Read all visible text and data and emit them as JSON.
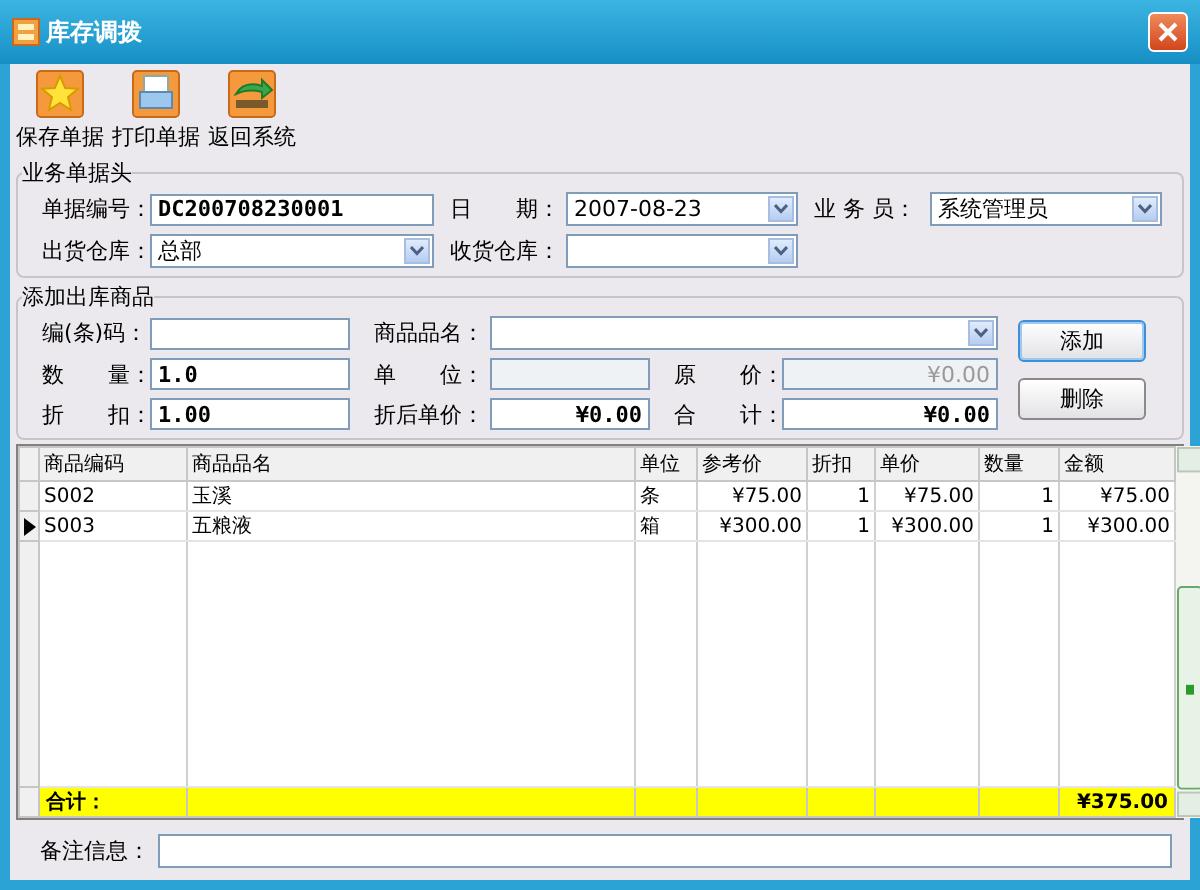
{
  "window": {
    "title": "库存调拨"
  },
  "toolbar": [
    {
      "label": "保存单据"
    },
    {
      "label": "打印单据"
    },
    {
      "label": "返回系统"
    }
  ],
  "header_group": {
    "title": "业务单据头",
    "rows": [
      [
        {
          "label": "单据编号：",
          "kind": "text",
          "value": "DC200708230001",
          "bold": true
        },
        {
          "label": "日　　期：",
          "kind": "combo",
          "value": "2007-08-23"
        },
        {
          "label": "业 务 员：",
          "kind": "combo",
          "value": "系统管理员"
        }
      ],
      [
        {
          "label": "出货仓库：",
          "kind": "combo",
          "value": "总部"
        },
        {
          "label": "收货仓库：",
          "kind": "combo"
        }
      ]
    ]
  },
  "item_group": {
    "title": "添加出库商品",
    "rows": [
      [
        {
          "label": "编(条)码：",
          "kind": "text"
        },
        {
          "label": "商品品名：",
          "kind": "combo"
        }
      ],
      [
        {
          "label": "数　　量：",
          "kind": "text",
          "value": "1.0",
          "bold": true
        },
        {
          "label": "单　　位：",
          "kind": "text",
          "disabled": true
        },
        {
          "label": "原　　价：",
          "kind": "money",
          "value": "¥0.00",
          "disabled": true
        }
      ],
      [
        {
          "label": "折　　扣：",
          "kind": "text",
          "value": "1.00",
          "bold": true
        },
        {
          "label": "折后单价：",
          "kind": "money",
          "value": "¥0.00",
          "bold": true
        },
        {
          "label": "合　　计：",
          "kind": "money",
          "value": "¥0.00",
          "bold": true
        }
      ]
    ],
    "buttons": [
      {
        "label": "添加",
        "focused": true
      },
      {
        "label": "删除",
        "focused": false
      }
    ]
  },
  "table": {
    "columns": [
      "商品编码",
      "商品品名",
      "单位",
      "参考价",
      "折扣",
      "单价",
      "数量",
      "金额"
    ],
    "rows": [
      {
        "selected": false,
        "cells": [
          "S002",
          "玉溪",
          "条",
          "¥75.00",
          "1",
          "¥75.00",
          "1",
          "¥75.00"
        ]
      },
      {
        "selected": true,
        "cells": [
          "S003",
          "五粮液",
          "箱",
          "¥300.00",
          "1",
          "¥300.00",
          "1",
          "¥300.00"
        ]
      }
    ],
    "total": {
      "label": "合计：",
      "amount": "¥375.00"
    }
  },
  "remarks": {
    "label": "备注信息："
  }
}
